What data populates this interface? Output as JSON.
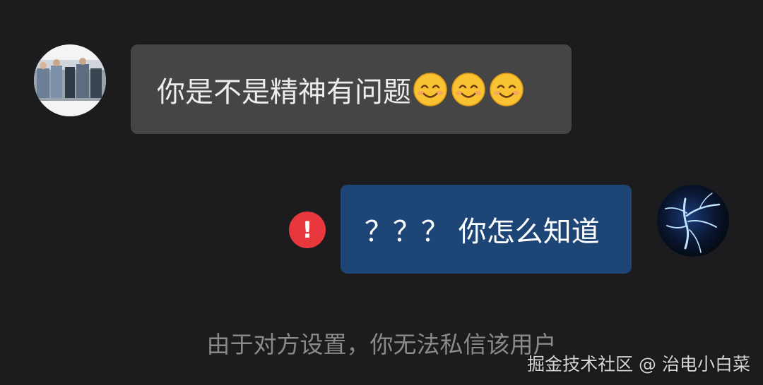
{
  "messages": [
    {
      "direction": "incoming",
      "text": "你是不是精神有问题",
      "emojis": [
        "smiling-face-emoji",
        "smiling-face-emoji",
        "smiling-face-emoji"
      ],
      "bubble_color": "#454545"
    },
    {
      "direction": "outgoing",
      "text": "？？？ 你怎么知道",
      "status": "send-failed",
      "status_icon_label": "!",
      "bubble_color": "#1d4677"
    }
  ],
  "system_notice": "由于对方设置，你无法私信该用户",
  "watermark": "掘金技术社区 @ 治电小白菜",
  "colors": {
    "background": "#1c1c1e",
    "error": "#e8383d",
    "notice_text": "#8a8a8c"
  }
}
